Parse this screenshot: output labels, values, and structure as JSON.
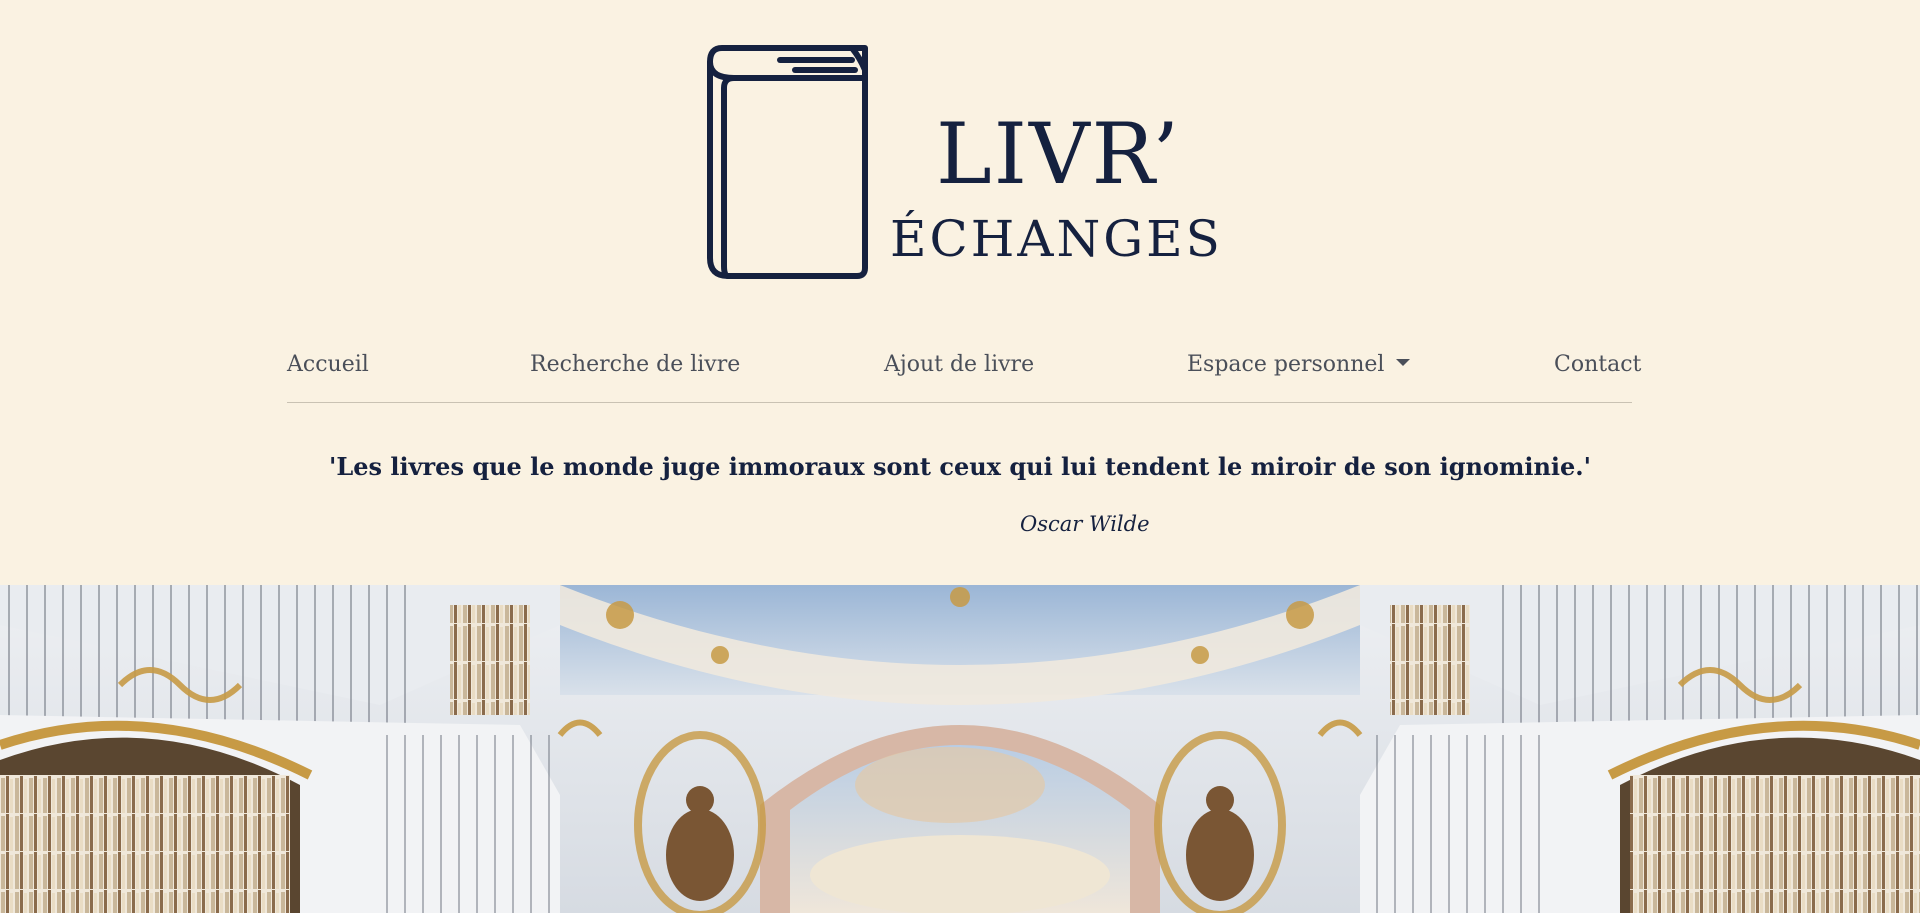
{
  "brand": {
    "line1": "LIVR’",
    "line2": "ÉCHANGES",
    "logo_icon": "book-icon"
  },
  "nav": {
    "items": [
      {
        "label": "Accueil"
      },
      {
        "label": "Recherche de livre"
      },
      {
        "label": "Ajout de livre"
      },
      {
        "label": "Espace personnel",
        "has_dropdown": true
      },
      {
        "label": "Contact"
      }
    ]
  },
  "quote": {
    "text": "'Les livres que le monde juge immoraux sont ceux qui lui tendent le miroir de son ignominie.'",
    "author": "Oscar Wilde"
  },
  "colors": {
    "background": "#faf2e2",
    "navy": "#15213f",
    "nav_text": "#4a4f59"
  }
}
